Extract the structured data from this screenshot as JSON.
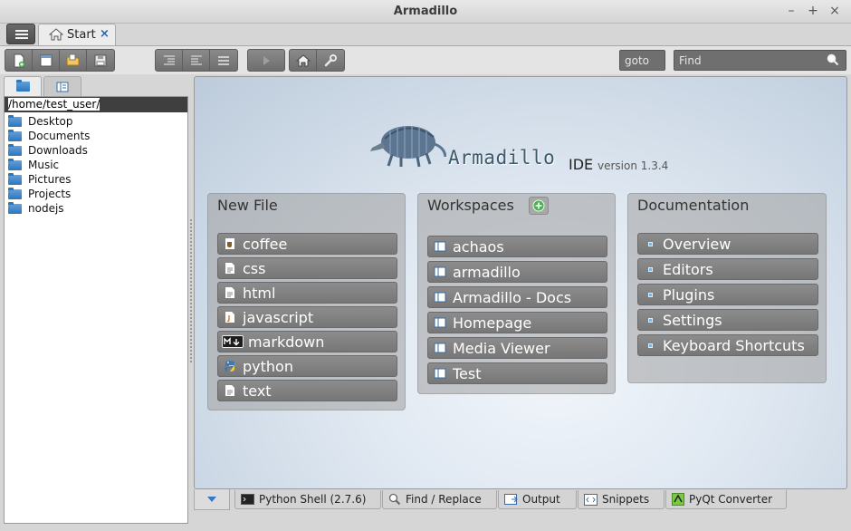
{
  "window": {
    "title": "Armadillo",
    "controls": [
      "–",
      "+",
      "×"
    ]
  },
  "tabs": [
    {
      "label": "Start",
      "icon": "home-icon",
      "close": "×"
    }
  ],
  "toolbar": {
    "goto_placeholder": "goto",
    "find_placeholder": "Find",
    "groups": [
      [
        "new-file-icon",
        "new-window-icon",
        "open-folder-icon",
        "save-icon"
      ],
      [
        "indent-icon",
        "unindent-icon",
        "comment-icon"
      ],
      [
        "run-icon"
      ],
      [
        "home-icon",
        "settings-wrench-icon"
      ]
    ]
  },
  "sidebar": {
    "path": "/home/test_user/",
    "items": [
      "Desktop",
      "Documents",
      "Downloads",
      "Music",
      "Pictures",
      "Projects",
      "nodejs"
    ]
  },
  "start": {
    "brand": "Armadillo",
    "ide": "IDE",
    "version": "version 1.3.4",
    "new_file": {
      "title": "New File",
      "items": [
        {
          "label": "coffee",
          "icon": "coffee-file-icon"
        },
        {
          "label": "css",
          "icon": "css-file-icon"
        },
        {
          "label": "html",
          "icon": "html-file-icon"
        },
        {
          "label": "javascript",
          "icon": "javascript-file-icon"
        },
        {
          "label": "markdown",
          "icon": "markdown-file-icon"
        },
        {
          "label": "python",
          "icon": "python-file-icon"
        },
        {
          "label": "text",
          "icon": "text-file-icon"
        }
      ]
    },
    "workspaces": {
      "title": "Workspaces",
      "items": [
        "achaos",
        "armadillo",
        "Armadillo - Docs",
        "Homepage",
        "Media Viewer",
        "Test"
      ]
    },
    "documentation": {
      "title": "Documentation",
      "items": [
        "Overview",
        "Editors",
        "Plugins",
        "Settings",
        "Keyboard Shortcuts"
      ]
    }
  },
  "bottom_tabs": [
    {
      "label": "Python Shell (2.7.6)",
      "icon": "terminal-icon"
    },
    {
      "label": "Find / Replace",
      "icon": "search-icon"
    },
    {
      "label": "Output",
      "icon": "output-icon"
    },
    {
      "label": "Snippets",
      "icon": "snippets-icon"
    },
    {
      "label": "PyQt Converter",
      "icon": "pyqt-icon"
    }
  ],
  "colors": {
    "accent_blue": "#2563a8",
    "folder": "#2f75bb",
    "item_bg": "#808080"
  }
}
